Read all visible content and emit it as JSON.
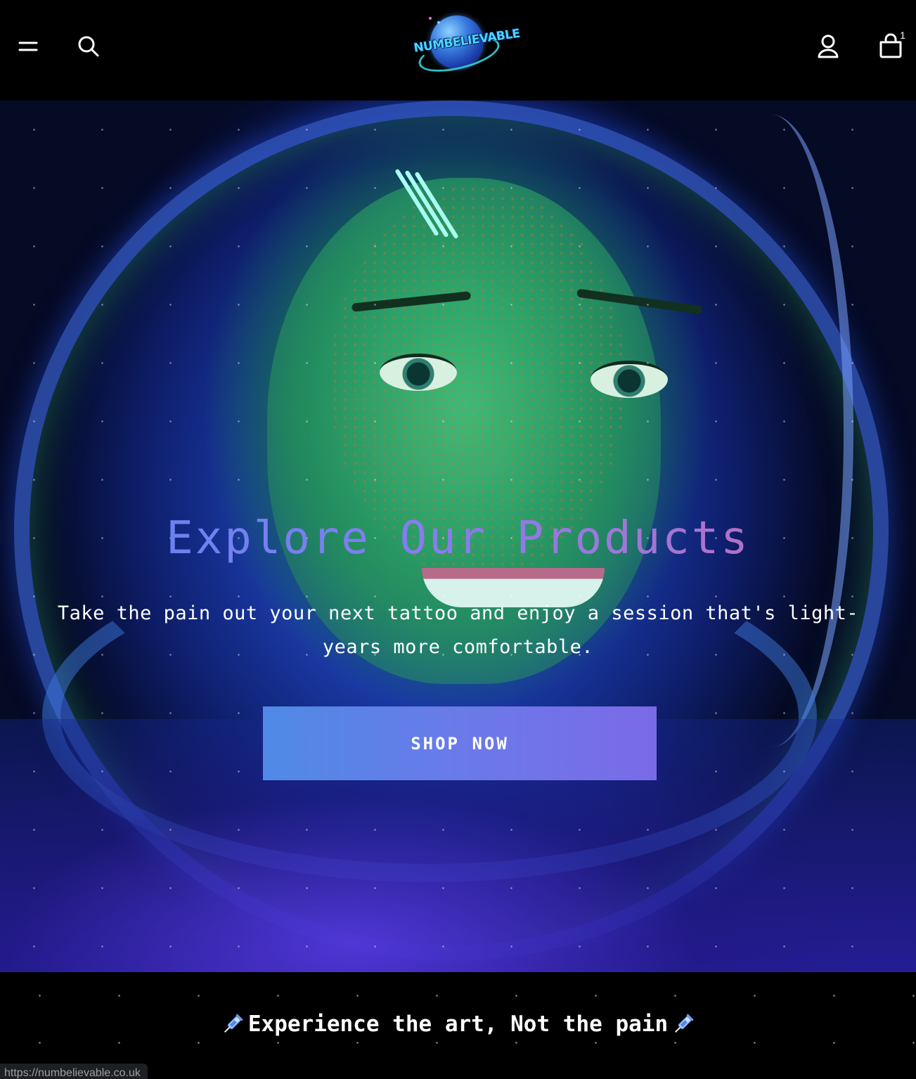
{
  "header": {
    "brand": "NUMBELIEVABLE",
    "cart_count": "1",
    "icons": {
      "menu": "hamburger-menu-icon",
      "search": "search-icon",
      "account": "user-account-icon",
      "cart": "cart-icon"
    }
  },
  "hero": {
    "title": "Explore Our Products",
    "subtitle": "Take the pain out your next tattoo and enjoy a session that's light-years more comfortable.",
    "cta_label": "SHOP NOW"
  },
  "banner": {
    "tagline": "Experience the art, Not the pain",
    "icon": "syringe-icon"
  },
  "status_bar": {
    "url": "https://numbelievable.co.uk"
  },
  "colors": {
    "background": "#000000",
    "button_start": "#4f8ae6",
    "button_end": "#7b6ae8",
    "title_start": "#5a86f0",
    "title_end": "#c76db0",
    "logo_text": "#49d7ff"
  }
}
